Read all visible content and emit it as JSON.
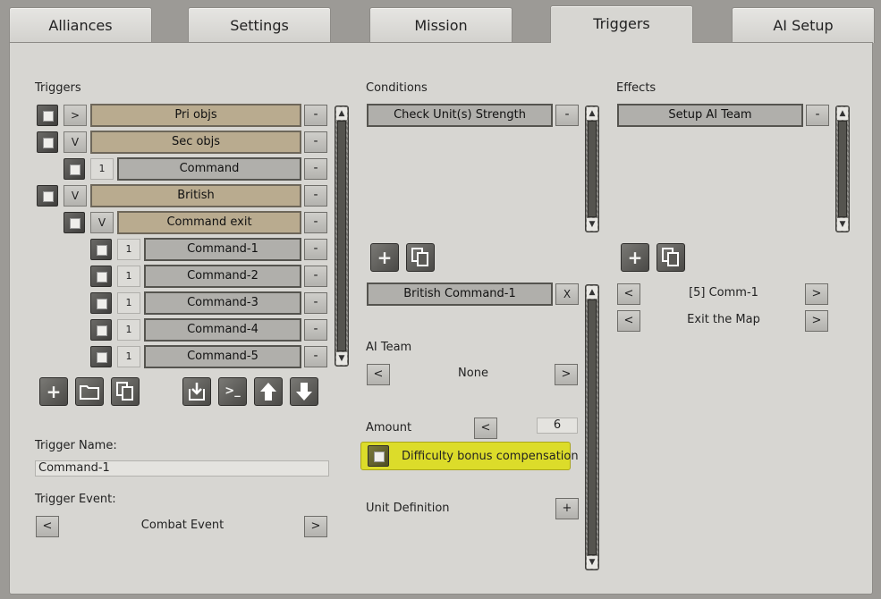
{
  "tabs": [
    "Alliances",
    "Settings",
    "Mission",
    "Triggers",
    "AI Setup"
  ],
  "triggers_section": {
    "title": "Triggers",
    "rows": [
      {
        "toggle": ">",
        "label": "Pri objs"
      },
      {
        "toggle": "V",
        "label": "Sec objs"
      },
      {
        "toggle": "1",
        "label": "Command"
      },
      {
        "toggle": "V",
        "label": "British"
      },
      {
        "toggle": "V",
        "label": "Command exit"
      },
      {
        "toggle": "1",
        "label": "Command-1"
      },
      {
        "toggle": "1",
        "label": "Command-2"
      },
      {
        "toggle": "1",
        "label": "Command-3"
      },
      {
        "toggle": "1",
        "label": "Command-4"
      },
      {
        "toggle": "1",
        "label": "Command-5"
      }
    ],
    "remove_label": "-"
  },
  "trigger_name": {
    "label": "Trigger Name:",
    "value": "Command-1"
  },
  "trigger_event": {
    "label": "Trigger Event:",
    "value": "Combat Event",
    "prev": "<",
    "next": ">"
  },
  "conditions": {
    "title": "Conditions",
    "items": [
      "Check Unit(s) Strength"
    ],
    "remove_label": "-",
    "selected": {
      "label": "British Command-1",
      "close": "X"
    },
    "ai_team": {
      "label": "AI Team",
      "value": "None",
      "prev": "<",
      "next": ">"
    },
    "amount": {
      "label": "Amount",
      "dec": "<",
      "value": "6"
    },
    "difficulty": {
      "label": "Difficulty bonus compensation"
    },
    "unit_definition": {
      "label": "Unit Definition",
      "add": "+"
    }
  },
  "effects": {
    "title": "Effects",
    "items": [
      "Setup AI Team"
    ],
    "remove_label": "-",
    "pickers": [
      {
        "value": "[5] Comm-1",
        "prev": "<",
        "next": ">"
      },
      {
        "value": "Exit the Map",
        "prev": "<",
        "next": ">"
      }
    ]
  },
  "icons": {
    "add": "+",
    "folder": "folder-icon",
    "copy": "copy-icon",
    "import": "import-icon",
    "console": ">_",
    "up": "arrow-up-icon",
    "down": "arrow-down-icon"
  },
  "colors": {
    "highlight": "#dcdc2a",
    "tan_row": "#b9ab8f"
  }
}
